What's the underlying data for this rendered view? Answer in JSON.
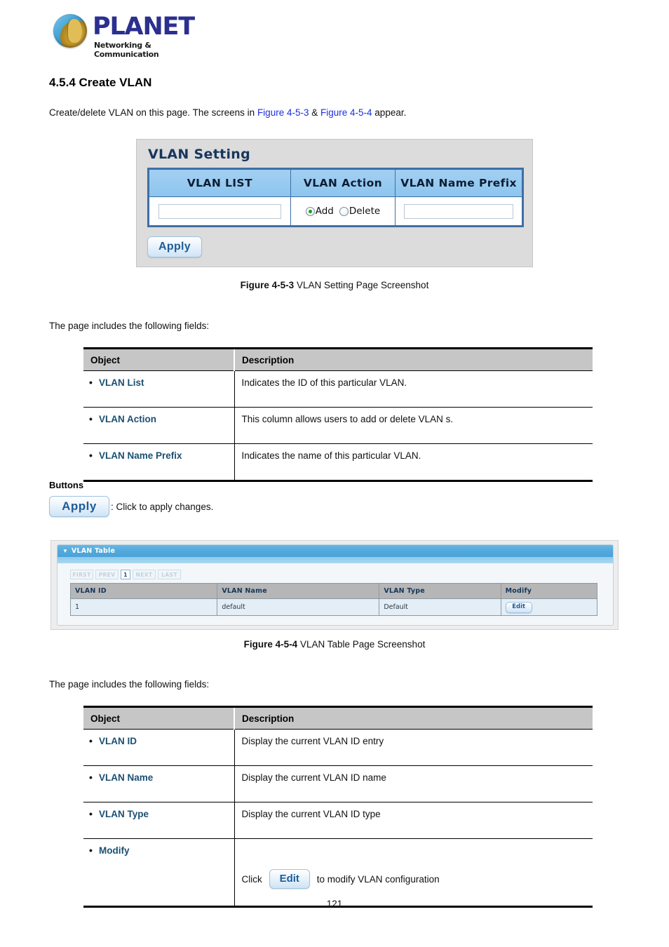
{
  "brand": {
    "name": "PLANET",
    "tagline": "Networking & Communication",
    "logo_icon": "planet-globe-icon",
    "name_color": "#2b2f8f"
  },
  "section": {
    "heading": "4.5.4 Create VLAN",
    "intro_prefix": "Create/delete VLAN on this page. The screens in ",
    "intro_link_1": "Figure 4-5-3",
    "intro_amp": " & ",
    "intro_link_2": "Figure 4-5-4",
    "intro_suffix": " appear.",
    "link_color": "#1a30e0"
  },
  "figure1": {
    "panel_title": "VLAN Setting",
    "headers": [
      "VLAN LIST",
      "VLAN Action",
      "VLAN Name Prefix"
    ],
    "vlan_list_value": "",
    "vlan_list_placeholder": "",
    "radios": [
      {
        "label": "Add",
        "checked": true
      },
      {
        "label": "Delete",
        "checked": false
      }
    ],
    "vlan_name_prefix_value": "",
    "vlan_name_prefix_placeholder": "",
    "apply_label": "Apply",
    "caption_bold": "Figure 4-5-3",
    "caption_rest": " VLAN Setting Page Screenshot",
    "header_color": "#8cc4ee",
    "border_color": "#3f6fa5"
  },
  "fields_intro_1": "The page includes the following fields:",
  "table1": {
    "columns": [
      "Object",
      "Description"
    ],
    "rows": [
      {
        "object": "VLAN List",
        "description": "Indicates the ID of this particular VLAN."
      },
      {
        "object": "VLAN Action",
        "description": "This column allows users to add or delete VLAN s."
      },
      {
        "object": "VLAN Name Prefix",
        "description": "Indicates the name of this particular VLAN."
      }
    ],
    "header_bg": "#c6c6c6",
    "object_color": "#1b4f72"
  },
  "buttons_section": {
    "heading": "Buttons",
    "apply_label": "Apply",
    "apply_description": ": Click to apply changes."
  },
  "figure2": {
    "panel_title": "VLAN Table",
    "caret_icon": "chevron-down-icon",
    "pager": [
      {
        "label": "FIRST",
        "active": false
      },
      {
        "label": "PREV",
        "active": false
      },
      {
        "label": "1",
        "active": true
      },
      {
        "label": "NEXT",
        "active": false
      },
      {
        "label": "LAST",
        "active": false
      }
    ],
    "columns": [
      "VLAN ID",
      "VLAN Name",
      "VLAN Type",
      "Modify"
    ],
    "rows": [
      {
        "vlan_id": "1",
        "vlan_name": "default",
        "vlan_type": "Default",
        "modify_label": "Edit"
      }
    ],
    "caption_bold": "Figure 4-5-4",
    "caption_rest": " VLAN Table Page Screenshot",
    "bar_color": "#4aa2d8",
    "header_bg": "#b6b6b6",
    "row_bg": "#e4eef6"
  },
  "fields_intro_2": "The page includes the following fields:",
  "table2": {
    "columns": [
      "Object",
      "Description"
    ],
    "rows": [
      {
        "object": "VLAN ID",
        "description": "Display the current VLAN ID entry"
      },
      {
        "object": "VLAN Name",
        "description": "Display the current VLAN ID name"
      },
      {
        "object": "VLAN Type",
        "description": "Display the current VLAN ID type"
      }
    ],
    "modify_row": {
      "object": "Modify",
      "click_text": "Click",
      "edit_label": "Edit",
      "after_text": "to modify VLAN configuration"
    }
  },
  "page_number": "121"
}
